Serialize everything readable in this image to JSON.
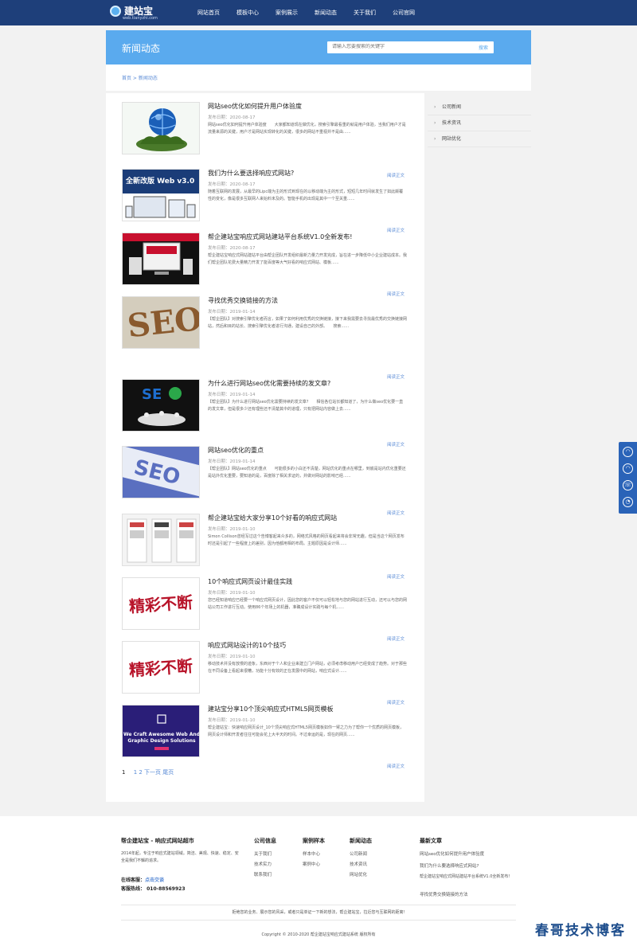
{
  "header": {
    "logo_name": "建站宝",
    "logo_url": "web.tianyzhi.com",
    "nav": [
      "网站首页",
      "模板中心",
      "案例展示",
      "新闻动态",
      "关于我们",
      "公司官网"
    ]
  },
  "banner": {
    "title": "新闻动态",
    "search_placeholder": "请输入您要搜索的关键字",
    "search_button": "搜索"
  },
  "breadcrumb": "首页 > 新闻动态",
  "articles": [
    {
      "title": "网站seo优化如何提升用户体验度",
      "date": "发布日期：2020-08-17",
      "summary": "网站seo优化如何提升用户体验度　　大家都知道现在做优化，搜索引擎最看重的就是用户体验，当我们用户才是流量来源的关键，用户才是网站实现转化的关键，很多的网站不重视并不是由......",
      "more": "阅读正文"
    },
    {
      "title": "我们为什么要选择响应式网站?",
      "date": "发布日期：2020-08-17",
      "summary": "随着互联网的发展，从最早的Lipc端为主的形式到现在的以移动端为主的形式，短短几年时间就发生了如此颠覆性的变化，像是很多互联网人来始料未及的。智能手机的出现是其中一个至关重......",
      "more": "阅读正文"
    },
    {
      "title": "帮企建站宝响应式网站建站平台系统V1.0全新发布!",
      "date": "发布日期：2020-08-17",
      "summary": "帮企建站宝响应式网站建站平台由帮企团队开发组织最新力量力开发完成，旨在进一步降低中小企业建站成本。我们帮企团队花费大量精力开发了能百度等大气好看的响应式网站、模板......",
      "more": "阅读正文"
    },
    {
      "title": "寻找优秀交换链接的方法",
      "date": "发布日期：2019-01-14",
      "summary": "【帮企团队】对搜索引擎优化者而言，如果了如何利用优秀的交换链接，接下来我需要去寻找最优秀的交换链接网站，然后和目的站长、搜索引擎优化者进行沟通，建设自己的外部。　　搜索......",
      "more": "阅读正文"
    },
    {
      "title": "为什么进行网站seo优化需要持续的发文章?",
      "date": "发布日期：2019-01-14",
      "summary": "【帮企团队】为什么进行网站seo优化需要持续的发文章?　　相信各位站长都知道了，为什么做seo优化要一直的发文章，但是很多少还有理些还不清楚其中的道理，只有把网站内容做上去......",
      "more": "阅读正文"
    },
    {
      "title": "网站seo优化的重点",
      "date": "发布日期：2019-01-14",
      "summary": "【帮企团队】网站seo优化的重点　　可能很多的小白还不清楚，网站优化的重点在哪里，到底是站内优化重要还是站外优化重要，要知道的是，百度除了相关求证的，并做对网站的影响已经......",
      "more": "阅读正文"
    },
    {
      "title": "帮企建站宝给大家分享10个好看的响应式网站",
      "date": "发布日期：2019-01-10",
      "summary": "Simon Collison曾经写过这个告博客起来众多的，网络式风格的网页看起来将会非常无趣，但是当这个网页发布时还是引起了一些程度上的差别，因为他都用相的布局。主题原因是设计师......",
      "more": "阅读正文"
    },
    {
      "title": "10个响应式网页设计最佳实践",
      "date": "发布日期：2019-01-10",
      "summary": "您已经知道响应已经要一个响应式网页设计，因此您的客户不仅可以轻松地与您的网站进行互动，还可以与您的网站公司工作进行互动。使用86个年场上的机器，准确成设计实践与每个机......",
      "more": "阅读正文"
    },
    {
      "title": "响应式网站设计的10个技巧",
      "date": "发布日期：2019-01-10",
      "summary": "移动技术并没有放慢的迹象，东西对于个人和企业来建立门户网站，必须考虑移动用户已经变成了趋势。对于那些在不同设备上看起来很糟，功能十分有效的正在发展中的网站，响应式设计......",
      "more": "阅读正文"
    },
    {
      "title": "建站宝分享10个顶尖响应式HTML5网页模板",
      "date": "发布日期：2019-01-10",
      "summary": "帮企建站宝：快速响应网页设计_10个顶尖响应式HTML5网页模板如你一臂之力为了帮你一个优质的网页模板，网页设计师和开发者往往可能会花上大半天的时间。不过幸运的是，现在的网页......",
      "more": "阅读正文"
    }
  ],
  "pager": {
    "current": "1",
    "pages": "1 2 下一页 尾页"
  },
  "sidebar": [
    "公司新闻",
    "技术资讯",
    "网站优化"
  ],
  "footer": {
    "brand_title": "帮企建站宝 - 响应式网站超市",
    "brand_desc": "2014年起，专注于响应式建站领域。简洁、美观、快速、稳定、安全是我们不懈的追求。",
    "online_label": "在线客服：",
    "online_link": "点击交谈",
    "hotline": "客服热线： 010-88569923",
    "col_company": {
      "title": "公司信息",
      "links": [
        "关于我们",
        "技术实力",
        "联系我们"
      ]
    },
    "col_cases": {
      "title": "案例样本",
      "links": [
        "样本中心",
        "案例中心"
      ]
    },
    "col_news": {
      "title": "新闻动态",
      "links": [
        "公司新闻",
        "技术资讯",
        "网站优化"
      ]
    },
    "col_latest": {
      "title": "最新文章",
      "links": [
        "网站seo优化如何提升用户体验度",
        "我们为什么要选择响应式网站?",
        "帮企建站宝响应式网站建站平台系统V1.0全新发布!",
        "寻找优秀交换链接的方法"
      ]
    },
    "disclaimer": "拒绝您的业务、展示您的风采，或者只是单证一下新的想法，帮企建站宝，拉近您与互联网的距离!",
    "copyright": "Copyright © 2010-2020 帮企建站宝响应式建站系统 版权所有"
  },
  "watermark": "春哥技术博客"
}
